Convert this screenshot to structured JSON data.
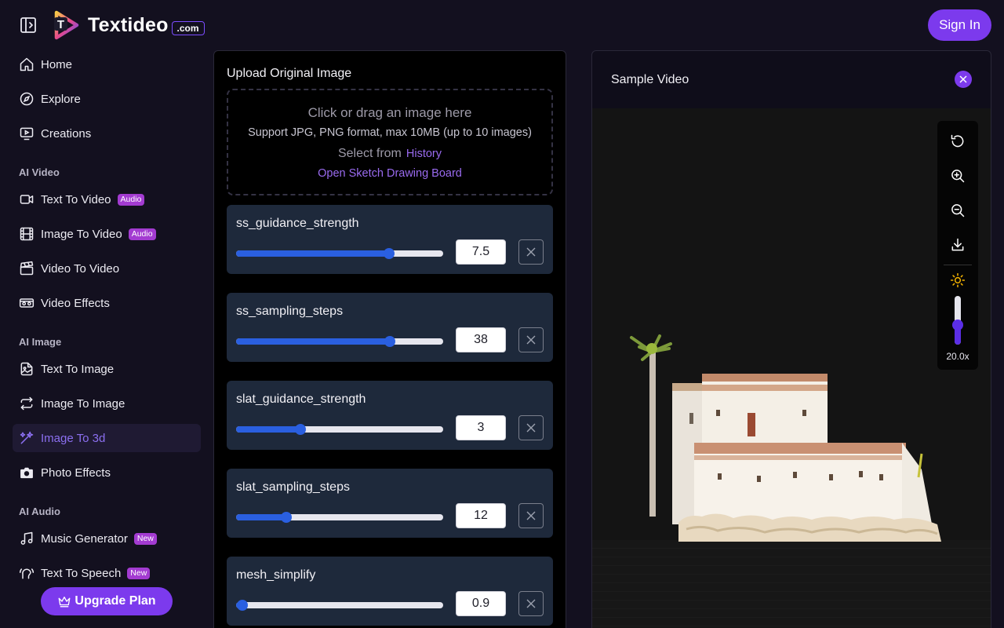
{
  "header": {
    "brand": "Textideo",
    "brand_badge": ".com",
    "signin_label": "Sign In"
  },
  "sidebar": {
    "items": [
      {
        "label": "Home",
        "icon": "home-icon"
      },
      {
        "label": "Explore",
        "icon": "compass-icon"
      },
      {
        "label": "Creations",
        "icon": "monitor-play-icon"
      }
    ],
    "sections": [
      {
        "title": "AI Video",
        "items": [
          {
            "label": "Text To Video",
            "icon": "video-camera-icon",
            "badge": "Audio"
          },
          {
            "label": "Image To Video",
            "icon": "film-icon",
            "badge": "Audio"
          },
          {
            "label": "Video To Video",
            "icon": "clapperboard-icon"
          },
          {
            "label": "Video Effects",
            "icon": "vr-glasses-icon"
          }
        ]
      },
      {
        "title": "AI Image",
        "items": [
          {
            "label": "Text To Image",
            "icon": "image-text-icon"
          },
          {
            "label": "Image To Image",
            "icon": "arrows-repeat-icon"
          },
          {
            "label": "Image To 3d",
            "icon": "wand-sparkle-icon",
            "active": true
          },
          {
            "label": "Photo Effects",
            "icon": "camera-icon"
          }
        ]
      },
      {
        "title": "AI Audio",
        "items": [
          {
            "label": "Music Generator",
            "icon": "music-note-icon",
            "badge": "New"
          },
          {
            "label": "Text To Speech",
            "icon": "speech-icon",
            "badge": "New"
          }
        ]
      }
    ],
    "upgrade_label": "Upgrade Plan"
  },
  "upload": {
    "title": "Upload Original Image",
    "drop_text": "Click or drag an image here",
    "support_text": "Support JPG, PNG format, max 10MB (up to 10 images)",
    "select_from": "Select from",
    "history_link": "History",
    "sketch_link": "Open Sketch Drawing Board"
  },
  "params": [
    {
      "label": "ss_guidance_strength",
      "value": "7.5",
      "fraction": 0.737
    },
    {
      "label": "ss_sampling_steps",
      "value": "38",
      "fraction": 0.742
    },
    {
      "label": "slat_guidance_strength",
      "value": "3",
      "fraction": 0.311
    },
    {
      "label": "slat_sampling_steps",
      "value": "12",
      "fraction": 0.242
    },
    {
      "label": "mesh_simplify",
      "value": "0.9",
      "fraction": 0.03
    }
  ],
  "video": {
    "title": "Sample Video",
    "tools": [
      "reset-view-icon",
      "zoom-in-icon",
      "zoom-out-icon",
      "download-icon"
    ],
    "brightness_icon": "sun-icon",
    "zoom_level": "20.0x",
    "brightness_fraction": 0.4
  },
  "colors": {
    "accent": "#7c3aed",
    "slider_blue": "#2a5fe0",
    "param_bg": "#1e293b",
    "badge": "#a33bd1"
  }
}
